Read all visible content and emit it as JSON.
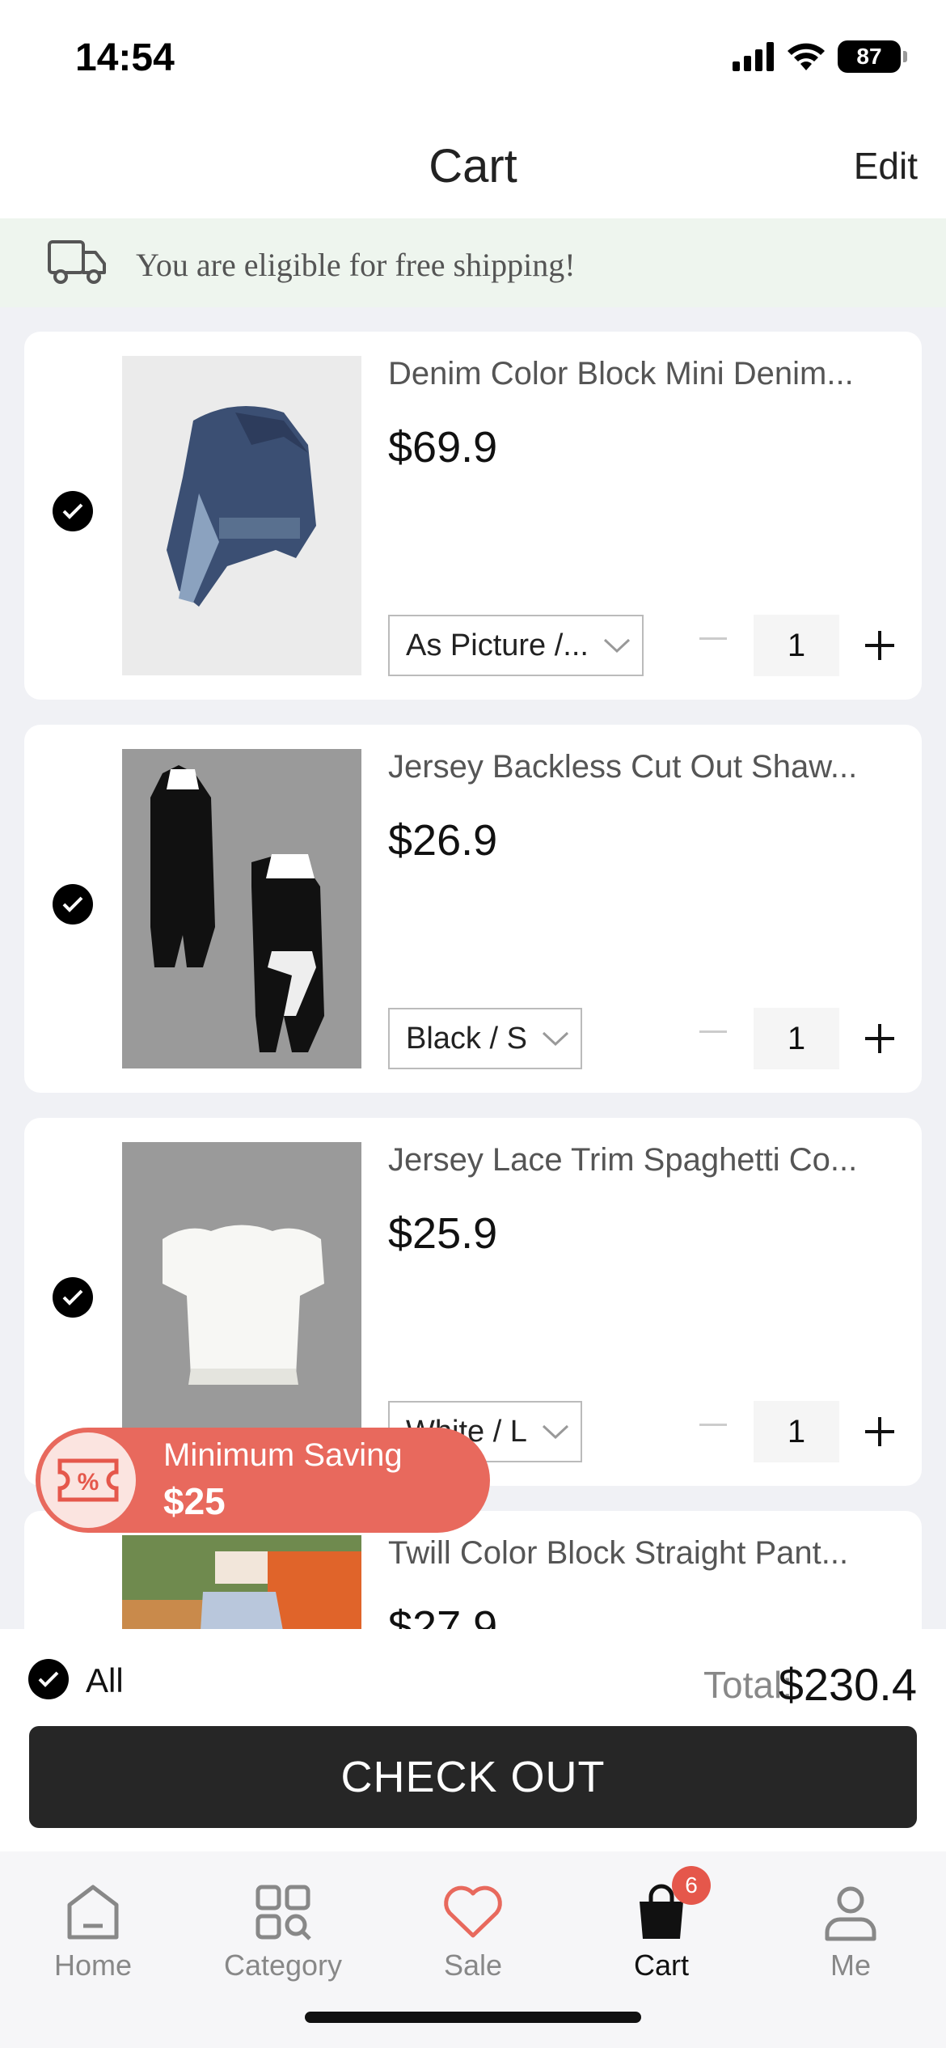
{
  "status_bar": {
    "time": "14:54",
    "battery": "87"
  },
  "header": {
    "title": "Cart",
    "edit_label": "Edit"
  },
  "shipping_banner": {
    "text": "You are eligible for free shipping!"
  },
  "cart_items": [
    {
      "name": "Denim Color Block Mini Denim...",
      "price": "$69.9",
      "variant": "As Picture /...",
      "quantity": "1",
      "selected": true
    },
    {
      "name": "Jersey Backless Cut Out Shaw...",
      "price": "$26.9",
      "variant": "Black / S",
      "quantity": "1",
      "selected": true
    },
    {
      "name": "Jersey Lace Trim Spaghetti Co...",
      "price": "$25.9",
      "variant": "White / L",
      "quantity": "1",
      "selected": true
    },
    {
      "name": "Twill Color Block Straight Pant...",
      "price": "$27.9",
      "selected": true
    }
  ],
  "saving_pill": {
    "title": "Minimum Saving",
    "value": "$25"
  },
  "summary": {
    "all_label": "All",
    "total_label": "Total:",
    "total_value": "$230.4",
    "checkout_label": "CHECK OUT"
  },
  "tabbar": {
    "items": [
      {
        "label": "Home"
      },
      {
        "label": "Category"
      },
      {
        "label": "Sale"
      },
      {
        "label": "Cart",
        "badge": "6"
      },
      {
        "label": "Me"
      }
    ]
  },
  "colors": {
    "accent_red": "#e8695d",
    "banner_bg": "#eef5ee",
    "checkout_bg": "#262626"
  }
}
